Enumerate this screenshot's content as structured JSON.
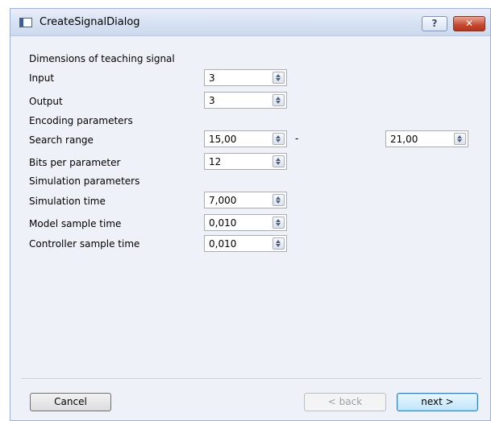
{
  "window": {
    "title": "CreateSignalDialog",
    "help_label": "?",
    "close_label": "✕"
  },
  "form": {
    "dimensions_header": "Dimensions of teaching signal",
    "input": {
      "label": "Input",
      "value": "3"
    },
    "output": {
      "label": "Output",
      "value": "3"
    },
    "encoding_header": "Encoding parameters",
    "search_range": {
      "label": "Search range",
      "min": "15,00",
      "separator": "-",
      "max": "21,00"
    },
    "bits_per_parameter": {
      "label": "Bits per parameter",
      "value": "12"
    },
    "simulation_header": "Simulation parameters",
    "simulation_time": {
      "label": "Simulation time",
      "value": "7,000"
    },
    "model_sample_time": {
      "label": "Model sample time",
      "value": "0,010"
    },
    "controller_sample_time": {
      "label": "Controller sample time",
      "value": "0,010"
    }
  },
  "buttons": {
    "cancel": "Cancel",
    "back": "< back",
    "next": "next >"
  },
  "colors": {
    "background": "#eef1f7",
    "next_accent": "#3c7fb1",
    "close_red": "#c6472e"
  }
}
